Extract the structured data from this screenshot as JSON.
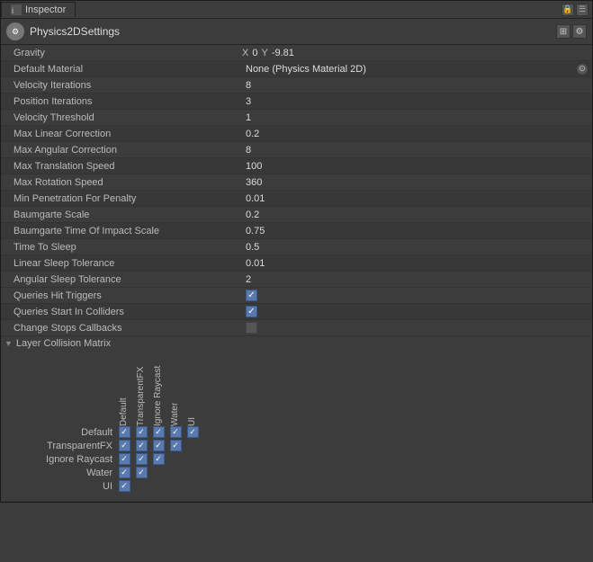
{
  "window": {
    "tab_label": "Inspector",
    "lock_icon": "🔒",
    "menu_icon": "☰"
  },
  "component": {
    "title": "Physics2DSettings",
    "icon_label": "⚙",
    "bookmark_icon": "⊞",
    "settings_icon": "⚙"
  },
  "fields": {
    "gravity": {
      "label": "Gravity",
      "x_label": "X",
      "x_value": "0",
      "y_label": "Y",
      "y_value": "-9.81"
    },
    "default_material": {
      "label": "Default Material",
      "value": "None (Physics Material 2D)"
    },
    "rows": [
      {
        "label": "Velocity Iterations",
        "value": "8"
      },
      {
        "label": "Position Iterations",
        "value": "3"
      },
      {
        "label": "Velocity Threshold",
        "value": "1"
      },
      {
        "label": "Max Linear Correction",
        "value": "0.2"
      },
      {
        "label": "Max Angular Correction",
        "value": "8"
      },
      {
        "label": "Max Translation Speed",
        "value": "100"
      },
      {
        "label": "Max Rotation Speed",
        "value": "360"
      },
      {
        "label": "Min Penetration For Penalty",
        "value": "0.01"
      },
      {
        "label": "Baumgarte Scale",
        "value": "0.2"
      },
      {
        "label": "Baumgarte Time Of Impact Scale",
        "value": "0.75"
      },
      {
        "label": "Time To Sleep",
        "value": "0.5"
      },
      {
        "label": "Linear Sleep Tolerance",
        "value": "0.01"
      },
      {
        "label": "Angular Sleep Tolerance",
        "value": "2"
      }
    ],
    "checkboxes": [
      {
        "label": "Queries Hit Triggers",
        "checked": true
      },
      {
        "label": "Queries Start In Colliders",
        "checked": true
      },
      {
        "label": "Change Stops Callbacks",
        "checked": false
      }
    ],
    "layer_collision": {
      "label": "Layer Collision Matrix",
      "col_headers": [
        "Default",
        "TransparentFX",
        "Ignore Raycast",
        "Water",
        "UI"
      ],
      "rows": [
        {
          "label": "Default",
          "cells": [
            true,
            true,
            true,
            true,
            true
          ]
        },
        {
          "label": "TransparentFX",
          "cells": [
            true,
            true,
            true,
            true,
            false
          ]
        },
        {
          "label": "Ignore Raycast",
          "cells": [
            true,
            true,
            true,
            false,
            false
          ]
        },
        {
          "label": "Water",
          "cells": [
            true,
            true,
            false,
            false,
            false
          ]
        },
        {
          "label": "UI",
          "cells": [
            true,
            false,
            false,
            false,
            false
          ]
        }
      ]
    }
  }
}
